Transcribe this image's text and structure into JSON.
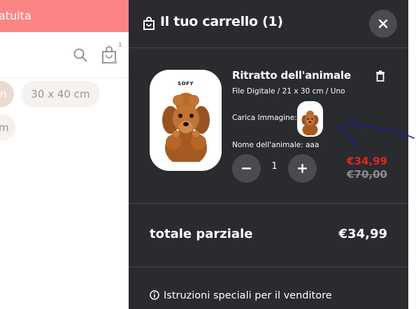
{
  "store": {
    "promo_text": "atuita",
    "bag_count": "1",
    "chips": [
      "n",
      "30 x 40 cm",
      "m"
    ]
  },
  "cart": {
    "title": "Il tuo carrello (1)",
    "item": {
      "title": "Ritratto dell'animale",
      "thumb_label": "SOFY",
      "variant": "File Digitale / 21 x 30 cm / Uno",
      "upload_label": "Carica Immagine:",
      "pet_name_label": "Nome dell'animale: aaa",
      "quantity": "1",
      "price_now": "€34,99",
      "price_old": "€70,00"
    },
    "subtotal_label": "totale parziale",
    "subtotal_value": "€34,99",
    "notes_label": "Istruzioni speciali per il venditore"
  },
  "colors": {
    "promo": "#fb8585",
    "drawer_bg": "#2a2b2f",
    "sale_price": "#e2271f",
    "annotation": "#1a1aa6"
  },
  "icons": [
    "search-icon",
    "shopping-bag-icon",
    "close-icon",
    "trash-icon",
    "minus-icon",
    "plus-icon",
    "info-icon"
  ]
}
